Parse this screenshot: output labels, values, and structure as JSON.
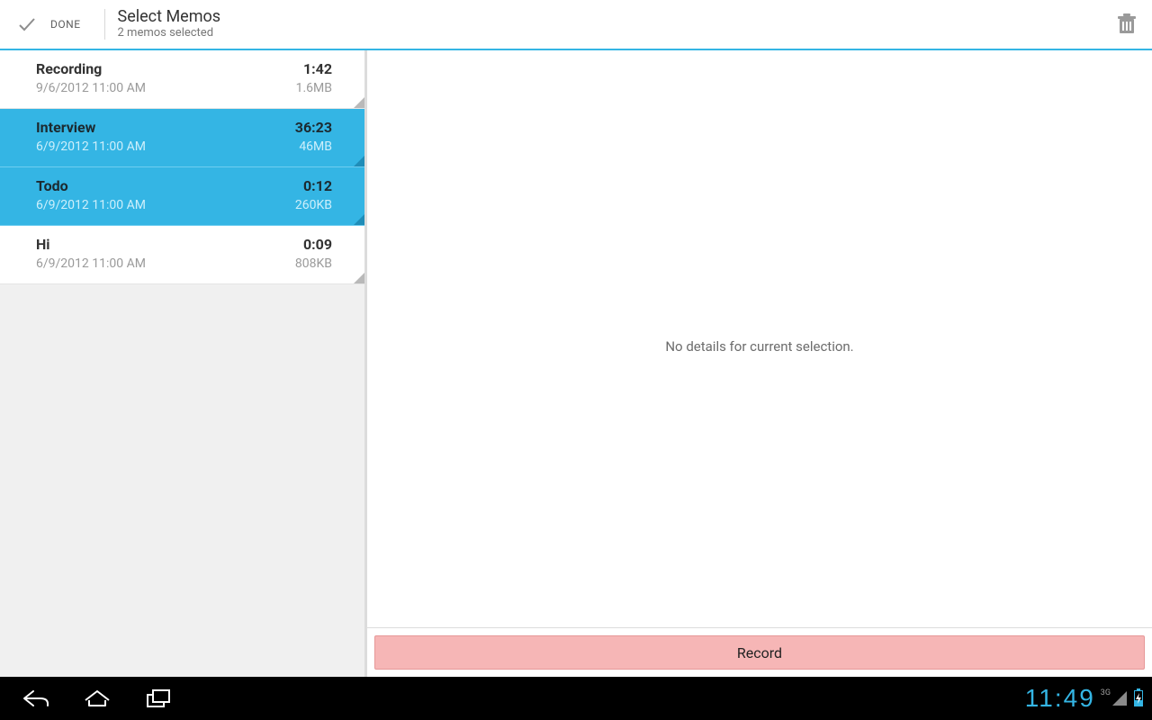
{
  "colors": {
    "accent": "#34b5e4",
    "record": "#f6b6b6"
  },
  "actionbar": {
    "done_label": "DONE",
    "title": "Select Memos",
    "subtitle": "2 memos selected"
  },
  "memos": [
    {
      "name": "Recording",
      "date": "9/6/2012 11:00 AM",
      "duration": "1:42",
      "size": "1.6MB",
      "selected": false
    },
    {
      "name": "Interview",
      "date": "6/9/2012 11:00 AM",
      "duration": "36:23",
      "size": "46MB",
      "selected": true
    },
    {
      "name": "Todo",
      "date": "6/9/2012 11:00 AM",
      "duration": "0:12",
      "size": "260KB",
      "selected": true
    },
    {
      "name": "Hi",
      "date": "6/9/2012 11:00 AM",
      "duration": "0:09",
      "size": "808KB",
      "selected": false
    }
  ],
  "detail": {
    "empty_message": "No details for current selection."
  },
  "record_button": {
    "label": "Record"
  },
  "statusbar": {
    "clock": "11:49",
    "network_label": "3G"
  }
}
